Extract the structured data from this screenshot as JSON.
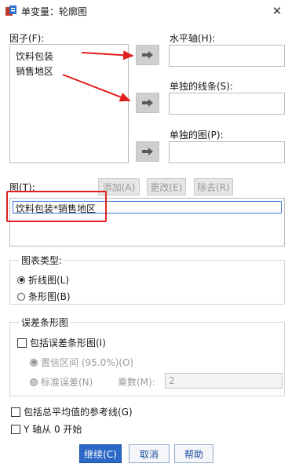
{
  "window": {
    "title": "单变量：轮廓图",
    "close_glyph": "✕"
  },
  "factors": {
    "label": "因子(F):",
    "items": [
      "饮料包装",
      "销售地区"
    ]
  },
  "targets": {
    "horizontal_axis": "水平轴(H):",
    "separate_lines": "单独的线条(S):",
    "separate_plots": "单独的图(P):"
  },
  "plots": {
    "label": "图(T):",
    "add": "添加(A)",
    "change": "更改(E)",
    "remove": "除去(R)",
    "items": [
      "饮料包装*销售地区"
    ]
  },
  "chart_type": {
    "label": "图表类型:",
    "line": "折线图(L)",
    "bar": "条形图(B)",
    "selected": "line"
  },
  "error_bars": {
    "label": "误差条形图",
    "include": "包括误差条形图(I)",
    "confidence": "置信区间 (95.0%)(O)",
    "std_error": "标准误差(N)",
    "multiplier_label": "乘数(M):",
    "multiplier_value": "2"
  },
  "options": {
    "ref_line": "包括总平均值的参考线(G)",
    "y_zero": "Y 轴从 0 开始"
  },
  "footer": {
    "continue": "继续(C)",
    "cancel": "取消",
    "help": "帮助"
  },
  "colors": {
    "accent": "#2a67c6",
    "annotation": "#e02020"
  },
  "icons": [
    "app-icon",
    "close-icon",
    "arrow-right-icon"
  ]
}
